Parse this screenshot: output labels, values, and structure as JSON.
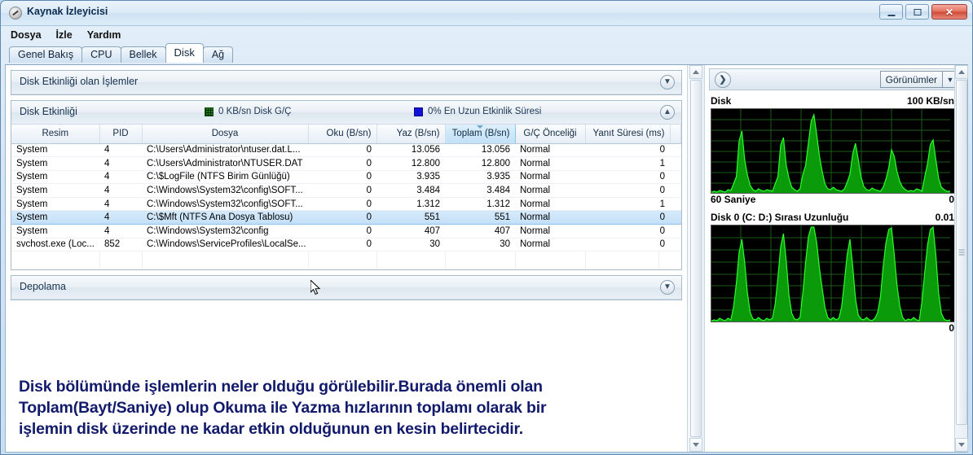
{
  "window": {
    "title": "Kaynak İzleyicisi",
    "icon": "resource-monitor-icon",
    "buttons": {
      "minimize": "minimize-icon",
      "maximize": "maximize-icon",
      "close": "✕"
    }
  },
  "menubar": {
    "items": [
      "Dosya",
      "İzle",
      "Yardım"
    ]
  },
  "tabs": [
    {
      "label": "Genel Bakış",
      "active": false
    },
    {
      "label": "CPU",
      "active": false
    },
    {
      "label": "Bellek",
      "active": false
    },
    {
      "label": "Disk",
      "active": true
    },
    {
      "label": "Ağ",
      "active": false
    }
  ],
  "sections": {
    "processes": {
      "title": "Disk Etkinliği olan İşlemler",
      "chevron": "▼"
    },
    "disk_activity": {
      "title": "Disk Etkinliği",
      "chevron": "▲",
      "legend_io": "0 KB/sn Disk G/Ç",
      "legend_time": "0% En Uzun Etkinlik Süresi",
      "legend_io_color": "#1f7a1f",
      "legend_time_color": "#1212d6"
    },
    "storage": {
      "title": "Depolama",
      "chevron": "▼"
    }
  },
  "table": {
    "columns": [
      {
        "label": "Resim",
        "align": "left",
        "sorted": false
      },
      {
        "label": "PID",
        "align": "left",
        "sorted": false
      },
      {
        "label": "Dosya",
        "align": "left",
        "sorted": false
      },
      {
        "label": "Oku (B/sn)",
        "align": "right",
        "sorted": false
      },
      {
        "label": "Yaz (B/sn)",
        "align": "right",
        "sorted": false
      },
      {
        "label": "Toplam (B/sn)",
        "align": "right",
        "sorted": true
      },
      {
        "label": "G/Ç Önceliği",
        "align": "left",
        "sorted": false
      },
      {
        "label": "Yanıt Süresi (ms)",
        "align": "right",
        "sorted": false
      }
    ],
    "rows": [
      {
        "image": "System",
        "pid": "4",
        "file": "C:\\Users\\Administrator\\ntuser.dat.L...",
        "read": "0",
        "write": "13.056",
        "total": "13.056",
        "priority": "Normal",
        "response": "0",
        "selected": false
      },
      {
        "image": "System",
        "pid": "4",
        "file": "C:\\Users\\Administrator\\NTUSER.DAT",
        "read": "0",
        "write": "12.800",
        "total": "12.800",
        "priority": "Normal",
        "response": "1",
        "selected": false
      },
      {
        "image": "System",
        "pid": "4",
        "file": "C:\\$LogFile (NTFS Birim Günlüğü)",
        "read": "0",
        "write": "3.935",
        "total": "3.935",
        "priority": "Normal",
        "response": "0",
        "selected": false
      },
      {
        "image": "System",
        "pid": "4",
        "file": "C:\\Windows\\System32\\config\\SOFT...",
        "read": "0",
        "write": "3.484",
        "total": "3.484",
        "priority": "Normal",
        "response": "0",
        "selected": false
      },
      {
        "image": "System",
        "pid": "4",
        "file": "C:\\Windows\\System32\\config\\SOFT...",
        "read": "0",
        "write": "1.312",
        "total": "1.312",
        "priority": "Normal",
        "response": "1",
        "selected": false
      },
      {
        "image": "System",
        "pid": "4",
        "file": "C:\\$Mft (NTFS Ana Dosya Tablosu)",
        "read": "0",
        "write": "551",
        "total": "551",
        "priority": "Normal",
        "response": "0",
        "selected": true
      },
      {
        "image": "System",
        "pid": "4",
        "file": "C:\\Windows\\System32\\config",
        "read": "0",
        "write": "407",
        "total": "407",
        "priority": "Normal",
        "response": "0",
        "selected": false
      },
      {
        "image": "svchost.exe (Loc...",
        "pid": "852",
        "file": "C:\\Windows\\ServiceProfiles\\LocalSe...",
        "read": "0",
        "write": "30",
        "total": "30",
        "priority": "Normal",
        "response": "0",
        "selected": false
      }
    ]
  },
  "annotation": {
    "line1": "Disk bölümünde işlemlerin neler olduğu görülebilir.Burada önemli olan",
    "line2": "Toplam(Bayt/Saniye) olup Okuma ile Yazma hızlarının toplamı olarak bir",
    "line3": "işlemin disk üzerinde ne kadar etkin olduğunun en kesin belirtecidir.",
    "color": "#121a6b"
  },
  "right_panel": {
    "expand_button": "❯",
    "views_label": "Görünümler",
    "views_arrow": "▼",
    "graphs": [
      {
        "title": "Disk",
        "max_label": "100 KB/sn",
        "min_label": "0",
        "duration_label": "60 Saniye",
        "line_color": "#00d000",
        "fill_color": "#009a00",
        "grid_color": "#1c5c1c"
      },
      {
        "title": "Disk 0 (C: D:) Sırası Uzunluğu",
        "max_label": "0.01",
        "min_label": "0",
        "duration_label": "",
        "line_color": "#00d000",
        "fill_color": "#009a00",
        "grid_color": "#1c5c1c"
      }
    ]
  },
  "chart_data": [
    {
      "type": "area",
      "title": "Disk",
      "ylabel": "KB/sn",
      "xlabel": "60 Saniye",
      "ylim": [
        0,
        100
      ],
      "grid": true,
      "values": [
        2,
        3,
        2,
        4,
        3,
        2,
        5,
        4,
        12,
        20,
        62,
        74,
        40,
        22,
        10,
        5,
        3,
        6,
        4,
        3,
        5,
        4,
        3,
        12,
        20,
        58,
        66,
        34,
        18,
        8,
        4,
        3,
        6,
        22,
        34,
        60,
        86,
        94,
        70,
        44,
        26,
        12,
        6,
        4,
        8,
        5,
        4,
        3,
        6,
        14,
        24,
        48,
        62,
        40,
        20,
        9,
        5,
        4,
        7,
        5,
        4,
        3,
        8,
        18,
        30,
        52,
        44,
        26,
        12,
        6,
        4,
        3,
        5,
        4,
        6,
        5,
        4,
        20,
        36,
        58,
        64,
        40,
        18,
        8,
        4,
        3
      ]
    },
    {
      "type": "area",
      "title": "Disk 0 (C: D:) Sırası Uzunluğu",
      "ylabel": "",
      "xlabel": "",
      "ylim": [
        0,
        0.01
      ],
      "grid": true,
      "values": [
        2,
        3,
        2,
        4,
        3,
        2,
        4,
        3,
        16,
        40,
        72,
        86,
        62,
        30,
        10,
        4,
        3,
        5,
        4,
        3,
        4,
        3,
        4,
        18,
        46,
        78,
        92,
        64,
        28,
        9,
        4,
        3,
        6,
        30,
        62,
        88,
        100,
        100,
        82,
        44,
        18,
        7,
        4,
        3,
        6,
        4,
        3,
        4,
        5,
        16,
        42,
        70,
        86,
        58,
        24,
        8,
        4,
        3,
        6,
        4,
        3,
        4,
        8,
        26,
        58,
        84,
        96,
        98,
        70,
        32,
        12,
        5,
        3,
        4,
        5,
        4,
        3,
        22,
        52,
        80,
        96,
        100,
        72,
        30,
        10,
        4
      ]
    }
  ]
}
